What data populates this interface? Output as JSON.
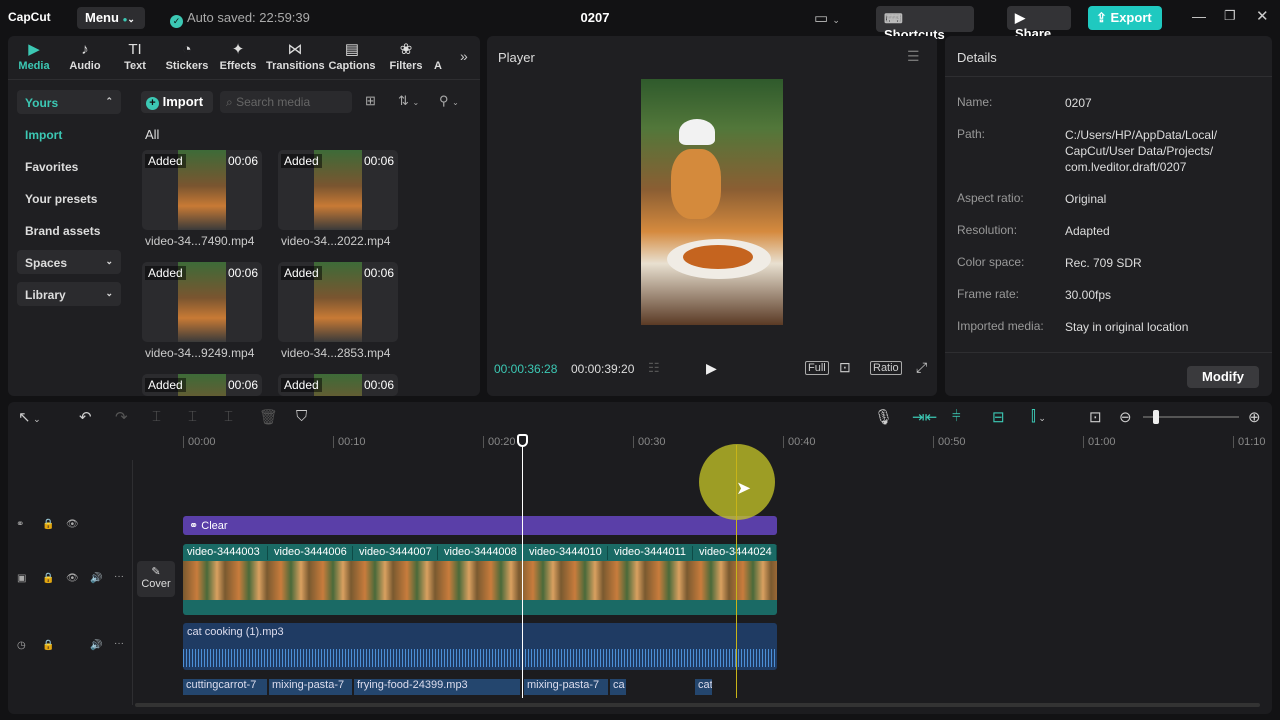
{
  "app": {
    "logo": "CapCut",
    "menu": "Menu",
    "autosave": "Auto saved: 22:59:39",
    "project_title": "0207"
  },
  "toolbar": {
    "shortcuts": "Shortcuts",
    "share": "Share",
    "export": "Export"
  },
  "media_tabs": [
    {
      "label": "Media",
      "icon": "▶"
    },
    {
      "label": "Audio",
      "icon": "♪"
    },
    {
      "label": "Text",
      "icon": "TI"
    },
    {
      "label": "Stickers",
      "icon": "◔"
    },
    {
      "label": "Effects",
      "icon": "✦"
    },
    {
      "label": "Transitions",
      "icon": "⋈"
    },
    {
      "label": "Captions",
      "icon": "▤"
    },
    {
      "label": "Filters",
      "icon": "❀"
    },
    {
      "label": "A",
      "icon": ""
    }
  ],
  "sidebar": {
    "yours": "Yours",
    "import": "Import",
    "favorites": "Favorites",
    "presets": "Your presets",
    "brand": "Brand assets",
    "spaces": "Spaces",
    "library": "Library"
  },
  "media": {
    "import_btn": "Import",
    "search_placeholder": "Search media",
    "all": "All",
    "added": "Added",
    "items": [
      {
        "name": "video-34...7490.mp4",
        "dur": "00:06"
      },
      {
        "name": "video-34...2022.mp4",
        "dur": "00:06"
      },
      {
        "name": "video-34...9249.mp4",
        "dur": "00:06"
      },
      {
        "name": "video-34...2853.mp4",
        "dur": "00:06"
      },
      {
        "name": "",
        "dur": "00:06"
      },
      {
        "name": "",
        "dur": "00:06"
      }
    ]
  },
  "player": {
    "title": "Player",
    "current": "00:00:36:28",
    "total": "00:00:39:20",
    "full": "Full",
    "ratio": "Ratio"
  },
  "details": {
    "title": "Details",
    "modify": "Modify",
    "rows": [
      {
        "label": "Name:",
        "value": "0207"
      },
      {
        "label": "Path:",
        "value": "C:/Users/HP/AppData/Local/ CapCut/User Data/Projects/ com.lveditor.draft/0207"
      },
      {
        "label": "Aspect ratio:",
        "value": "Original"
      },
      {
        "label": "Resolution:",
        "value": "Adapted"
      },
      {
        "label": "Color space:",
        "value": "Rec. 709 SDR"
      },
      {
        "label": "Frame rate:",
        "value": "30.00fps"
      },
      {
        "label": "Imported media:",
        "value": "Stay in original location"
      }
    ]
  },
  "timeline": {
    "ruler": [
      "00:00",
      "00:10",
      "00:20",
      "00:30",
      "00:40",
      "00:50",
      "01:00",
      "01:10"
    ],
    "effect_clip": "Clear",
    "cover": "Cover",
    "video_clips": [
      "video-3444003",
      "video-3444006",
      "video-3444007",
      "video-3444008",
      "video-3444010",
      "video-3444011",
      "video-3444024"
    ],
    "music": "cat cooking (1).mp3",
    "sfx": [
      "cuttingcarrot-7",
      "mixing-pasta-7",
      "frying-food-24399.mp3",
      "mixing-pasta-7",
      "ca",
      "cat"
    ]
  },
  "colors": {
    "accent": "#3cc8b4",
    "export": "#1fc9c0",
    "effect": "#5a3fa8",
    "video": "#1a6a65",
    "audio": "#23406a"
  }
}
